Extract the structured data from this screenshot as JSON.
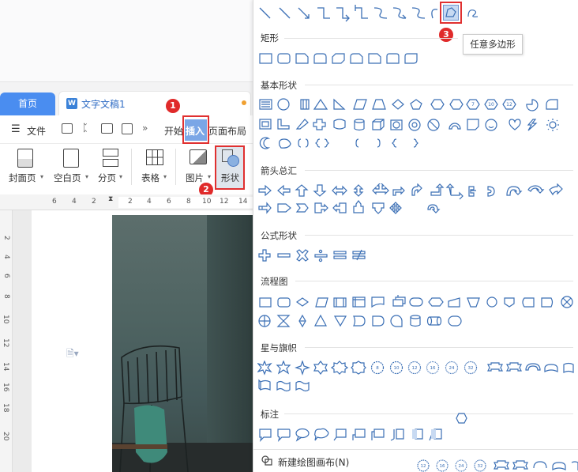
{
  "tabs": {
    "home": "首页",
    "document": "文字文稿1"
  },
  "menu": {
    "file": "文件",
    "start": "开始",
    "insert": "插入",
    "layout": "页面布局"
  },
  "ribbon": {
    "cover_page": "封面页",
    "blank_page": "空白页",
    "page_break": "分页",
    "table": "表格",
    "picture": "图片",
    "shapes": "形状"
  },
  "ruler": {
    "numbers": [
      "6",
      "4",
      "2",
      "2",
      "4",
      "6",
      "8",
      "10",
      "12",
      "14"
    ],
    "vnumbers": [
      "2",
      "4",
      "6",
      "8",
      "10",
      "12",
      "14",
      "16",
      "18",
      "20"
    ]
  },
  "shape_panel": {
    "categories": {
      "rectangle": "矩形",
      "basic": "基本形状",
      "arrows": "箭头总汇",
      "formula": "公式形状",
      "flowchart": "流程图",
      "stars": "星与旗帜",
      "callouts": "标注"
    },
    "tooltip": "任意多边形",
    "new_canvas": "新建绘图画布(N)",
    "star_numbers": [
      "8",
      "10",
      "12",
      "16",
      "24",
      "32"
    ],
    "footer_numbers": [
      "12",
      "16",
      "24",
      "32"
    ]
  },
  "annotations": {
    "step1": "1",
    "step2": "2",
    "step3": "3"
  },
  "colors": {
    "accent": "#4a8df0",
    "shape_stroke": "#3b6fb5",
    "annotation": "#e02a2a"
  }
}
